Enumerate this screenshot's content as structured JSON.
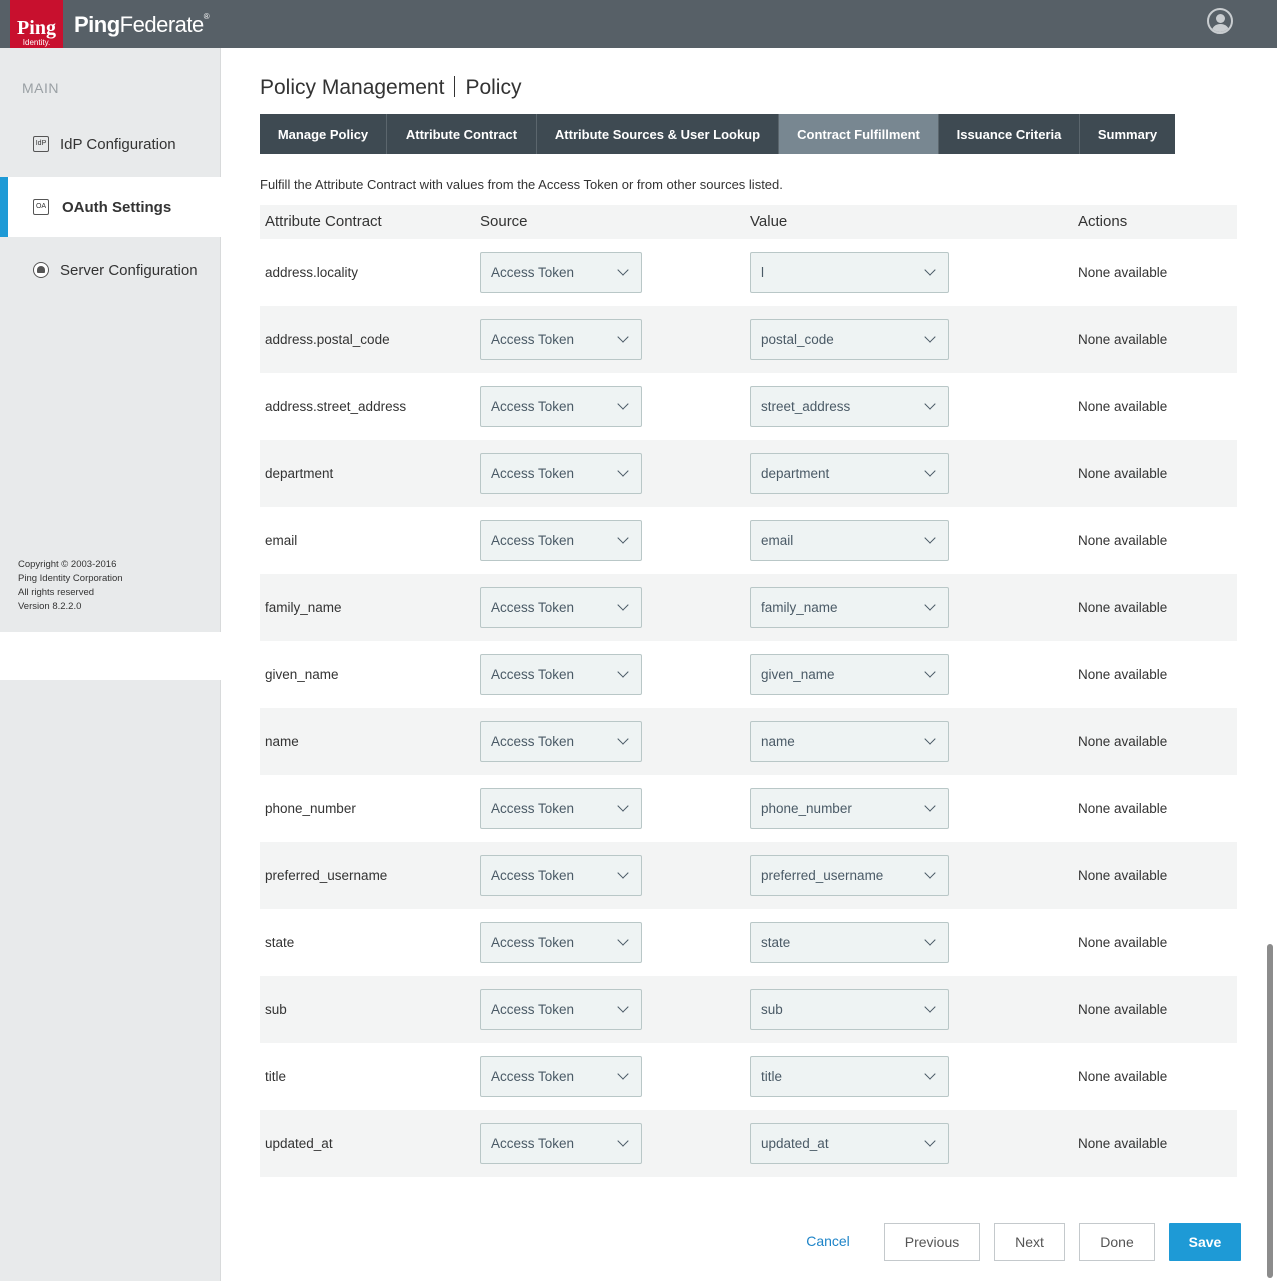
{
  "header": {
    "logo_text": "Ping",
    "logo_sub": "Identity.",
    "product_bold": "Ping",
    "product_rest": "Federate",
    "trademark": "®"
  },
  "sidebar": {
    "section_label": "MAIN",
    "items": [
      {
        "label": "IdP Configuration",
        "icon": "IdP"
      },
      {
        "label": "OAuth Settings",
        "icon": "OA"
      },
      {
        "label": "Server Configuration",
        "icon": ""
      }
    ],
    "copyright": [
      "Copyright © 2003-2016",
      "Ping Identity Corporation",
      "All rights reserved",
      "Version 8.2.2.0"
    ]
  },
  "page": {
    "title_left": "Policy Management",
    "title_right": "Policy",
    "intro": "Fulfill the Attribute Contract with values from the Access Token or from other sources listed."
  },
  "tabs": [
    {
      "label": "Manage Policy"
    },
    {
      "label": "Attribute Contract"
    },
    {
      "label": "Attribute Sources & User Lookup"
    },
    {
      "label": "Contract Fulfillment"
    },
    {
      "label": "Issuance Criteria"
    },
    {
      "label": "Summary"
    }
  ],
  "table": {
    "headers": [
      "Attribute Contract",
      "Source",
      "Value",
      "Actions"
    ],
    "rows": [
      {
        "attr": "address.locality",
        "source": "Access Token",
        "value": "l",
        "action": "None available"
      },
      {
        "attr": "address.postal_code",
        "source": "Access Token",
        "value": "postal_code",
        "action": "None available"
      },
      {
        "attr": "address.street_address",
        "source": "Access Token",
        "value": "street_address",
        "action": "None available"
      },
      {
        "attr": "department",
        "source": "Access Token",
        "value": "department",
        "action": "None available"
      },
      {
        "attr": "email",
        "source": "Access Token",
        "value": "email",
        "action": "None available"
      },
      {
        "attr": "family_name",
        "source": "Access Token",
        "value": "family_name",
        "action": "None available"
      },
      {
        "attr": "given_name",
        "source": "Access Token",
        "value": "given_name",
        "action": "None available"
      },
      {
        "attr": "name",
        "source": "Access Token",
        "value": "name",
        "action": "None available"
      },
      {
        "attr": "phone_number",
        "source": "Access Token",
        "value": "phone_number",
        "action": "None available"
      },
      {
        "attr": "preferred_username",
        "source": "Access Token",
        "value": "preferred_username",
        "action": "None available"
      },
      {
        "attr": "state",
        "source": "Access Token",
        "value": "state",
        "action": "None available"
      },
      {
        "attr": "sub",
        "source": "Access Token",
        "value": "sub",
        "action": "None available"
      },
      {
        "attr": "title",
        "source": "Access Token",
        "value": "title",
        "action": "None available"
      },
      {
        "attr": "updated_at",
        "source": "Access Token",
        "value": "updated_at",
        "action": "None available"
      }
    ]
  },
  "buttons": {
    "cancel": "Cancel",
    "previous": "Previous",
    "next": "Next",
    "done": "Done",
    "save": "Save"
  },
  "colors": {
    "topbar": "#576067",
    "brand_red": "#c8102e",
    "tab_bg": "#3e4a52",
    "tab_active": "#788791",
    "accent": "#1e9ad6"
  }
}
